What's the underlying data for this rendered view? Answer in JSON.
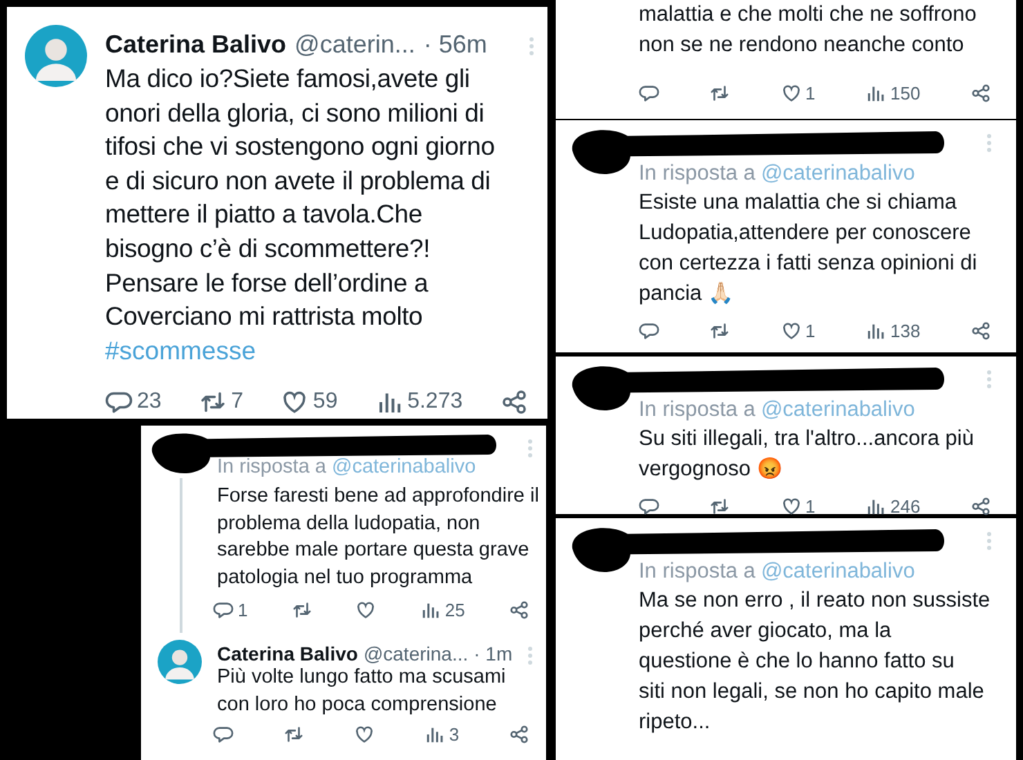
{
  "main_tweet": {
    "author": "Caterina Balivo",
    "handle": "@caterin...",
    "time": "· 56m",
    "text_lines": [
      "Ma dico io?Siete famosi,avete gli",
      "onori della gloria, ci sono milioni di",
      "tifosi che vi sostengono ogni giorno",
      "e di sicuro non avete il problema di",
      "mettere il piatto a tavola.Che",
      "bisogno c’è di scommettere?!",
      "Pensare le forse dell’ordine a",
      "Coverciano mi rattrista molto"
    ],
    "hashtag": "#scommesse",
    "actions": {
      "replies": "23",
      "reposts": "7",
      "likes": "59",
      "views": "5.273"
    }
  },
  "thread": [
    {
      "kind": "reply",
      "reply_label": "In risposta a",
      "reply_handle": "@caterinabalivo",
      "text_lines": [
        "Forse faresti bene ad approfondire il",
        "problema della ludopatia, non",
        "sarebbe male portare questa grave",
        "patologia nel tuo programma"
      ],
      "actions": {
        "replies": "1",
        "views": "25"
      }
    },
    {
      "kind": "author",
      "author": "Caterina Balivo",
      "handle": "@caterina...",
      "time": "· 1m",
      "text_lines": [
        "Più volte lungo fatto ma scusami",
        "con loro ho poca comprensione"
      ],
      "actions": {
        "views": "3"
      }
    }
  ],
  "right_column": [
    {
      "kind": "tail",
      "text_lines": [
        "malattia e che molti che ne soffrono",
        "non se ne rendono neanche conto"
      ],
      "actions": {
        "likes": "1",
        "views": "150"
      }
    },
    {
      "kind": "reply",
      "reply_label": "In risposta a",
      "reply_handle": "@caterinabalivo",
      "text_lines": [
        "Esiste una malattia che si chiama",
        "Ludopatia,attendere per conoscere",
        "con certezza i fatti senza opinioni di",
        "pancia"
      ],
      "emoji": "🙏🏻",
      "actions": {
        "likes": "1",
        "views": "138"
      }
    },
    {
      "kind": "reply",
      "reply_label": "In risposta a",
      "reply_handle": "@caterinabalivo",
      "text_lines": [
        "Su siti illegali, tra l'altro...ancora più",
        "vergognoso"
      ],
      "emoji": "😡",
      "actions": {
        "likes": "1",
        "views": "246"
      }
    },
    {
      "kind": "reply",
      "reply_label": "In risposta a",
      "reply_handle": "@caterinabalivo",
      "text_lines": [
        "Ma se non erro , il reato non sussiste",
        "perché aver giocato, ma la",
        "questione è che lo hanno fatto su",
        "siti non legali, se non ho capito male",
        "ripeto..."
      ]
    }
  ]
}
